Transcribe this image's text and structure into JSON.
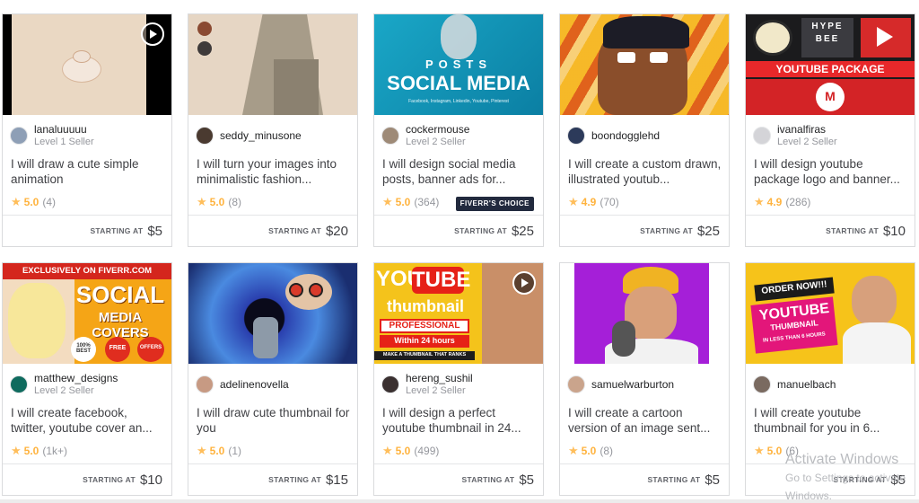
{
  "cards": [
    {
      "seller": "lanaluuuuu",
      "level": "Level 1 Seller",
      "title": "I will draw a cute simple animation",
      "rating": "5.0",
      "count": "(4)",
      "starting": "STARTING AT",
      "price": "$5",
      "thumb": {
        "texts": []
      }
    },
    {
      "seller": "seddy_minusone",
      "level": "",
      "title": "I will turn your images into minimalistic fashion...",
      "rating": "5.0",
      "count": "(8)",
      "starting": "STARTING AT",
      "price": "$20",
      "thumb": {
        "texts": []
      }
    },
    {
      "seller": "cockermouse",
      "level": "Level 2 Seller",
      "title": "I will design social media posts, banner ads for...",
      "rating": "5.0",
      "count": "(364)",
      "badge": "FIVERR'S CHOICE",
      "starting": "STARTING AT",
      "price": "$25",
      "thumb": {
        "texts": [
          "POSTS",
          "SOCIAL MEDIA",
          "Facebook, Instagram, Linkedin, Youtube, Pinterest"
        ]
      }
    },
    {
      "seller": "boondogglehd",
      "level": "",
      "title": "I will create a custom drawn, illustrated youtub...",
      "rating": "4.9",
      "count": "(70)",
      "starting": "STARTING AT",
      "price": "$25",
      "thumb": {
        "texts": []
      }
    },
    {
      "seller": "ivanalfiras",
      "level": "Level 2 Seller",
      "title": "I will design youtube package logo and banner...",
      "rating": "4.9",
      "count": "(286)",
      "starting": "STARTING AT",
      "price": "$10",
      "thumb": {
        "texts": [
          "HYPE",
          "BEE",
          "YOUTUBE PACKAGE",
          "M"
        ]
      }
    },
    {
      "seller": "matthew_designs",
      "level": "Level 2 Seller",
      "title": "I will create facebook, twitter, youtube cover an...",
      "rating": "5.0",
      "count": "(1k+)",
      "starting": "STARTING AT",
      "price": "$10",
      "thumb": {
        "texts": [
          "EXCLUSIVELY ON FIVERR.COM",
          "SOCIAL",
          "MEDIA COVERS",
          "100% BEST",
          "FREE",
          "OFFERS"
        ]
      }
    },
    {
      "seller": "adelinenovella",
      "level": "",
      "title": "I will draw cute thumbnail for you",
      "rating": "5.0",
      "count": "(1)",
      "starting": "STARTING AT",
      "price": "$15",
      "thumb": {
        "texts": []
      }
    },
    {
      "seller": "hereng_sushil",
      "level": "Level 2 Seller",
      "title": "I will design a perfect youtube thumbnail in 24...",
      "rating": "5.0",
      "count": "(499)",
      "starting": "STARTING AT",
      "price": "$5",
      "thumb": {
        "texts": [
          "YOU",
          "TUBE",
          "thumbnail",
          "PROFESSIONAL",
          "Within 24 hours",
          "MAKE A THUMBNAIL THAT RANKS"
        ]
      }
    },
    {
      "seller": "samuelwarburton",
      "level": "",
      "title": "I will create a cartoon version of an image sent...",
      "rating": "5.0",
      "count": "(8)",
      "starting": "STARTING AT",
      "price": "$5",
      "thumb": {
        "texts": []
      }
    },
    {
      "seller": "manuelbach",
      "level": "",
      "title": "I will create youtube thumbnail for you in 6...",
      "rating": "5.0",
      "count": "(6)",
      "starting": "STARTING AT",
      "price": "$5",
      "thumb": {
        "texts": [
          "ORDER NOW!!!",
          "YOUTUBE",
          "THUMBNAIL",
          "IN LESS THAN 6 HOURS"
        ]
      }
    }
  ],
  "watermark": {
    "line1": "Activate Windows",
    "line2": "Go to Settings to activate Windows."
  },
  "colors": {
    "star": "#ffbe5b",
    "rating": "#ffb33e",
    "border": "#dadbdd",
    "text": "#404145"
  }
}
